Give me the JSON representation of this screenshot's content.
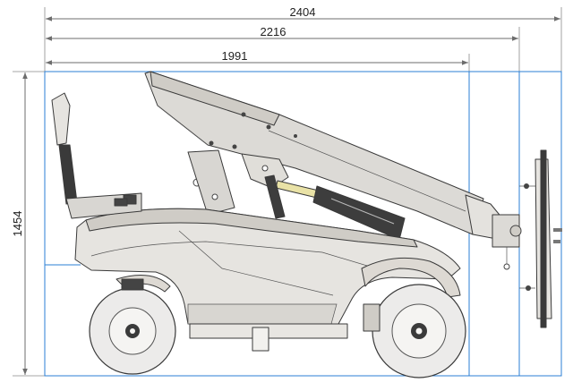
{
  "dimensions": {
    "overall_length": "2404",
    "length_to_bracket": "2216",
    "wheel_base_length": "1991",
    "height": "1454"
  },
  "colors": {
    "dimension_line": "#6d6d6d",
    "bounding_box": "#2b7fd4",
    "body": "#e6e4e0",
    "body_shade": "#cfccc6",
    "arm": "#dcdad6",
    "tire": "#ecebea",
    "dark": "#3a3a3a",
    "cylinder_rod": "#e9e2a6"
  }
}
